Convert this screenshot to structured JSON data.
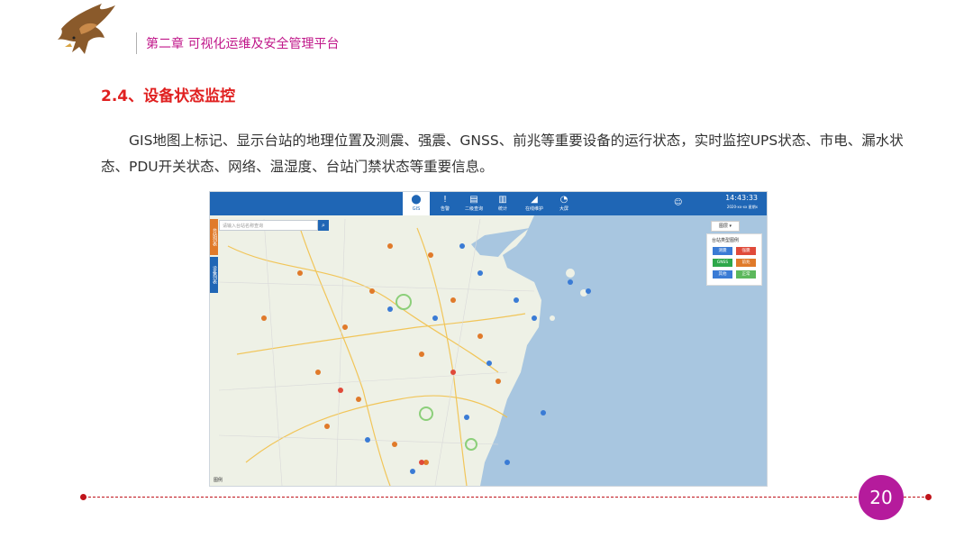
{
  "header": {
    "chapter": "第二章  可视化运维及安全管理平台"
  },
  "section": {
    "heading": "2.4、设备状态监控",
    "paragraph": "GIS地图上标记、显示台站的地理位置及测震、强震、GNSS、前兆等重要设备的运行状态，实时监控UPS状态、市电、漏水状态、PDU开关状态、网络、温湿度、台站门禁状态等重要信息。"
  },
  "screenshot": {
    "nav": [
      {
        "icon": "map-pin-icon",
        "glyph": "⬤",
        "label": "GIS"
      },
      {
        "icon": "alert-icon",
        "glyph": "!",
        "label": "告警"
      },
      {
        "icon": "query-icon",
        "glyph": "▤",
        "label": "二级查询"
      },
      {
        "icon": "chart-icon",
        "glyph": "▥",
        "label": "统计"
      },
      {
        "icon": "shoe-icon",
        "glyph": "◢",
        "label": "在线维护"
      },
      {
        "icon": "gauge-icon",
        "glyph": "◔",
        "label": "大屏"
      }
    ],
    "clock": {
      "time": "14:43:33",
      "date": "2020-xx-xx 星期x"
    },
    "search_placeholder": "请输入台站名称查询",
    "side_tabs": [
      "台站列表",
      "设备列表"
    ],
    "layers_label": "图层 ▾",
    "legend": {
      "title": "台站类型图例",
      "items": [
        {
          "label": "测震",
          "color": "#3a7bd5"
        },
        {
          "label": "强震",
          "color": "#e04a3a"
        },
        {
          "label": "GNSS",
          "color": "#2ea84a"
        },
        {
          "label": "前兆",
          "color": "#e07a2a"
        },
        {
          "label": "其他",
          "color": "#3a7bd5"
        },
        {
          "label": "正常",
          "color": "#5cb85c"
        }
      ]
    },
    "map_label": "图例"
  },
  "footer": {
    "page_number": "20"
  },
  "colors": {
    "accent_red": "#e02020",
    "chapter_magenta": "#c0178a",
    "page_circle": "#b51b9c",
    "nav_blue": "#1f66b5",
    "sea": "#a8c6e0"
  }
}
